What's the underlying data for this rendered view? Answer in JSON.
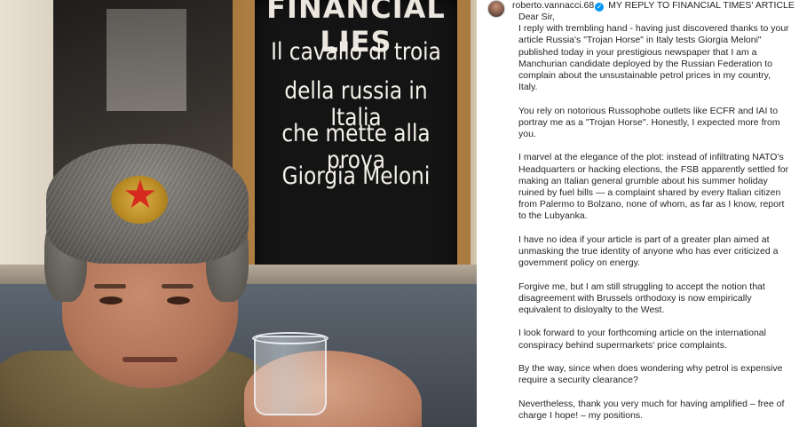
{
  "photo": {
    "board_header": "FINANCIAL LIES",
    "board_lines": [
      "Il cavallo di troia",
      "della russia in Italia",
      "che mette alla prova",
      "Giorgia Meloni"
    ]
  },
  "post": {
    "username": "roberto.vannacci.68",
    "title": "MY REPLY TO FINANCIAL TIMES' ARTICLE",
    "greeting": "Dear Sir,",
    "paragraphs": [
      "I reply with trembling hand - having just discovered thanks to your article Russia's \"Trojan Horse\" in Italy tests Giorgia Meloni\" published today in your prestigious newspaper that I am a Manchurian candidate deployed by the Russian Federation to complain about the unsustainable petrol prices in my country, Italy.",
      "You rely on notorious Russophobe outlets like ECFR and IAI to portray me as a \"Trojan Horse\". Honestly, I expected more from you.",
      "I marvel at the elegance of the plot: instead of infiltrating NATO's Headquarters or hacking elections, the FSB apparently settled for making an Italian general grumble about his summer holiday ruined by fuel bills — a complaint shared by every Italian citizen from Palermo to Bolzano, none of whom, as far as I know, report to the Lubyanka.",
      "I have no idea if your article is part of a greater plan aimed at unmasking the true identity of anyone who has ever criticized a government policy on energy.",
      "Forgive me, but I am still struggling to accept the notion that disagreement with Brussels orthodoxy is now empirically equivalent to disloyalty to the West.",
      "I look forward to your forthcoming article on the international conspiracy behind supermarkets' price complaints.",
      "By the way, since when does wondering why petrol is expensive require a security clearance?",
      "Nevertheless, thank you very much for having amplified – free of charge I hope! – my positions."
    ]
  },
  "colors": {
    "text": "#262626",
    "verified": "#0095f6",
    "board": "#141414",
    "frame": "#c99658"
  },
  "icons": {
    "verified": "verified-badge-icon",
    "star": "red-star-icon"
  }
}
